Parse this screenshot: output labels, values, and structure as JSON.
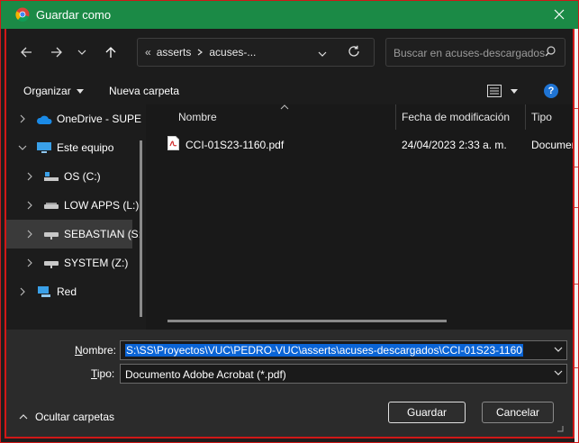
{
  "window": {
    "title": "Guardar como"
  },
  "nav": {
    "breadcrumb": [
      "asserts",
      "acuses-..."
    ],
    "breadcrumb_prefix": "«",
    "search_placeholder": "Buscar en acuses-descargados"
  },
  "toolbar": {
    "organize_label": "Organizar",
    "new_folder_label": "Nueva carpeta"
  },
  "sidebar": {
    "items": [
      {
        "label": "OneDrive - SUPE",
        "icon": "cloud-icon"
      },
      {
        "label": "Este equipo",
        "icon": "computer-icon"
      },
      {
        "label": "OS (C:)",
        "icon": "drive-icon"
      },
      {
        "label": "LOW APPS (L:)",
        "icon": "drive-icon"
      },
      {
        "label": "SEBASTIAN (S:",
        "icon": "network-drive-icon",
        "selected": true
      },
      {
        "label": "SYSTEM (Z:)",
        "icon": "drive-icon"
      },
      {
        "label": "Red",
        "icon": "network-icon"
      }
    ]
  },
  "files": {
    "columns": [
      "Nombre",
      "Fecha de modificación",
      "Tipo"
    ],
    "rows": [
      {
        "name": "CCI-01S23-1160.pdf",
        "date": "24/04/2023 2:33 a. m.",
        "type": "Documen"
      }
    ]
  },
  "form": {
    "name_label_prefix": "N",
    "name_label_rest": "ombre:",
    "name_value": "S:\\SS\\Proyectos\\VUC\\PEDRO-VUC\\asserts\\acuses-descargados\\CCI-01S23-1160",
    "type_label_prefix": "T",
    "type_label_rest": "ipo:",
    "type_value": "Documento Adobe Acrobat (*.pdf)"
  },
  "footer": {
    "hide_folders_label": "Ocultar carpetas",
    "save_label": "Guardar",
    "cancel_label": "Cancelar"
  },
  "colors": {
    "titlebar": "#1b8a46",
    "selection": "#0a64d6",
    "accent_border": "#d01818"
  }
}
